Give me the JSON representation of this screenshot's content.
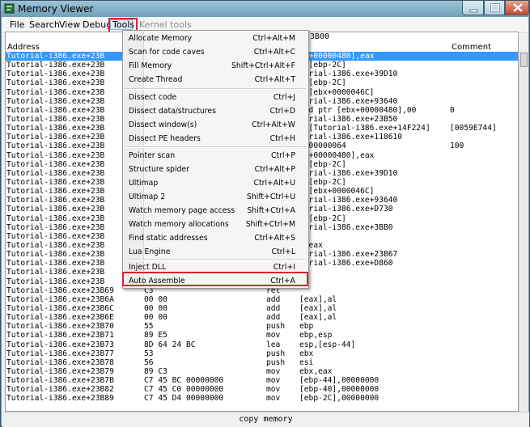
{
  "window": {
    "title": "Memory Viewer",
    "accent_color": "#d9232e",
    "selection_color": "#3399ff"
  },
  "menubar": {
    "items": [
      "File",
      "Search",
      "View",
      "Debug",
      "Tools"
    ],
    "disabled_item": "Kernel tools"
  },
  "header": {
    "address": "Address",
    "comment": "Comment",
    "partial": "3B00"
  },
  "rows": [
    {
      "addr": "Tutorial-i386.exe+23B",
      "bytes": "",
      "op": "",
      "args": "bx+00000480],eax",
      "comment": ""
    },
    {
      "addr": "Tutorial-i386.exe+23B",
      "bytes": "",
      "op": "",
      "args": "x,[ebp-2C]",
      "comment": ""
    },
    {
      "addr": "Tutorial-i386.exe+23B",
      "bytes": "",
      "op": "",
      "args": "torial-i386.exe+39D10",
      "comment": ""
    },
    {
      "addr": "Tutorial-i386.exe+23B",
      "bytes": "",
      "op": "",
      "args": "x,[ebp-2C]",
      "comment": ""
    },
    {
      "addr": "Tutorial-i386.exe+23B",
      "bytes": "",
      "op": "",
      "args": "x,[ebx+0000046C]",
      "comment": ""
    },
    {
      "addr": "Tutorial-i386.exe+23B",
      "bytes": "",
      "op": "",
      "args": "torial-i386.exe+93640",
      "comment": ""
    },
    {
      "addr": "Tutorial-i386.exe+23B",
      "bytes": "",
      "op": "",
      "args": "ord ptr [ebx+00000480],00",
      "comment": "0"
    },
    {
      "addr": "Tutorial-i386.exe+23B",
      "bytes": "",
      "op": "",
      "args": "torial-i386.exe+23B50",
      "comment": ""
    },
    {
      "addr": "Tutorial-i386.exe+23B",
      "bytes": "",
      "op": "",
      "args": "x,[Tutorial-i386.exe+14F224]",
      "comment": "[0059E744]"
    },
    {
      "addr": "Tutorial-i386.exe+23B",
      "bytes": "",
      "op": "",
      "args": "torial-i386.exe+118610",
      "comment": ""
    },
    {
      "addr": "Tutorial-i386.exe+23B",
      "bytes": "",
      "op": "",
      "args": "x,00000064",
      "comment": "100"
    },
    {
      "addr": "Tutorial-i386.exe+23B",
      "bytes": "",
      "op": "",
      "args": "bx+00000480],eax",
      "comment": ""
    },
    {
      "addr": "Tutorial-i386.exe+23B",
      "bytes": "",
      "op": "",
      "args": "x,[ebp-2C]",
      "comment": ""
    },
    {
      "addr": "Tutorial-i386.exe+23B",
      "bytes": "",
      "op": "",
      "args": "torial-i386.exe+39D10",
      "comment": ""
    },
    {
      "addr": "Tutorial-i386.exe+23B",
      "bytes": "",
      "op": "",
      "args": "x,[ebp-2C]",
      "comment": ""
    },
    {
      "addr": "Tutorial-i386.exe+23B",
      "bytes": "",
      "op": "",
      "args": "x,[ebx+0000046C]",
      "comment": ""
    },
    {
      "addr": "Tutorial-i386.exe+23B",
      "bytes": "",
      "op": "",
      "args": "torial-i386.exe+93640",
      "comment": ""
    },
    {
      "addr": "Tutorial-i386.exe+23B",
      "bytes": "",
      "op": "",
      "args": "torial-i386.exe+D730",
      "comment": ""
    },
    {
      "addr": "Tutorial-i386.exe+23B",
      "bytes": "",
      "op": "",
      "args": "x,[ebp-2C]",
      "comment": ""
    },
    {
      "addr": "Tutorial-i386.exe+23B",
      "bytes": "",
      "op": "",
      "args": "torial-i386.exe+3BB0",
      "comment": ""
    },
    {
      "addr": "Tutorial-i386.exe+23B",
      "bytes": "",
      "op": "",
      "args": "x",
      "comment": ""
    },
    {
      "addr": "Tutorial-i386.exe+23B",
      "bytes": "",
      "op": "",
      "args": "x,eax",
      "comment": ""
    },
    {
      "addr": "Tutorial-i386.exe+23B",
      "bytes": "",
      "op": "",
      "args": "torial-i386.exe+23B67",
      "comment": ""
    },
    {
      "addr": "Tutorial-i386.exe+23B",
      "bytes": "",
      "op": "",
      "args": "torial-i386.exe+D860",
      "comment": ""
    },
    {
      "addr": "Tutorial-i386.exe+23B",
      "bytes": "",
      "op": "",
      "args": "x",
      "comment": ""
    },
    {
      "addr": "Tutorial-i386.exe+23B",
      "bytes": "",
      "op": "",
      "args": "x",
      "comment": ""
    },
    {
      "addr": "Tutorial-i386.exe+23B69",
      "bytes": "C3",
      "op": "ret",
      "args": "",
      "comment": ""
    },
    {
      "addr": "Tutorial-i386.exe+23B6A",
      "bytes": "00 00",
      "op": "add",
      "args": "[eax],al",
      "comment": ""
    },
    {
      "addr": "Tutorial-i386.exe+23B6C",
      "bytes": "00 00",
      "op": "add",
      "args": "[eax],al",
      "comment": ""
    },
    {
      "addr": "Tutorial-i386.exe+23B6E",
      "bytes": "00 00",
      "op": "add",
      "args": "[eax],al",
      "comment": ""
    },
    {
      "addr": "Tutorial-i386.exe+23B70",
      "bytes": "55",
      "op": "push",
      "args": "ebp",
      "comment": ""
    },
    {
      "addr": "Tutorial-i386.exe+23B71",
      "bytes": "89 E5",
      "op": "mov",
      "args": "ebp,esp",
      "comment": ""
    },
    {
      "addr": "Tutorial-i386.exe+23B73",
      "bytes": "8D 64 24 BC",
      "op": "lea",
      "args": "esp,[esp-44]",
      "comment": ""
    },
    {
      "addr": "Tutorial-i386.exe+23B77",
      "bytes": "53",
      "op": "push",
      "args": "ebx",
      "comment": ""
    },
    {
      "addr": "Tutorial-i386.exe+23B78",
      "bytes": "56",
      "op": "push",
      "args": "esi",
      "comment": ""
    },
    {
      "addr": "Tutorial-i386.exe+23B79",
      "bytes": "89 C3",
      "op": "mov",
      "args": "ebx,eax",
      "comment": ""
    },
    {
      "addr": "Tutorial-i386.exe+23B7B",
      "bytes": "C7 45 BC 00000000",
      "op": "mov",
      "args": "[ebp-44],00000000",
      "comment": ""
    },
    {
      "addr": "Tutorial-i386.exe+23B82",
      "bytes": "C7 45 C0 00000000",
      "op": "mov",
      "args": "[ebp-40],00000000",
      "comment": ""
    },
    {
      "addr": "Tutorial-i386.exe+23B89",
      "bytes": "C7 45 D4 00000000",
      "op": "mov",
      "args": "[ebp-2C],00000000",
      "comment": ""
    }
  ],
  "tools_menu": [
    {
      "label": "Allocate Memory",
      "shortcut": "Ctrl+Alt+M"
    },
    {
      "label": "Scan for code caves",
      "shortcut": "Ctrl+Alt+C"
    },
    {
      "label": "Fill Memory",
      "shortcut": "Shift+Ctrl+Alt+F"
    },
    {
      "label": "Create Thread",
      "shortcut": "Ctrl+Alt+T"
    },
    {
      "label": "Dissect code",
      "shortcut": "Ctrl+J"
    },
    {
      "label": "Dissect data/structures",
      "shortcut": "Ctrl+D"
    },
    {
      "label": "Dissect window(s)",
      "shortcut": "Ctrl+Alt+W"
    },
    {
      "label": "Dissect PE headers",
      "shortcut": "Ctrl+H"
    },
    {
      "label": "Pointer scan",
      "shortcut": "Ctrl+P"
    },
    {
      "label": "Structure spider",
      "shortcut": "Ctrl+Alt+P"
    },
    {
      "label": "Ultimap",
      "shortcut": "Ctrl+Alt+U"
    },
    {
      "label": "Ultimap 2",
      "shortcut": "Shift+Ctrl+U"
    },
    {
      "label": "Watch memory page access",
      "shortcut": "Shift+Ctrl+A"
    },
    {
      "label": "Watch memory allocations",
      "shortcut": "Shift+Ctrl+M"
    },
    {
      "label": "Find static addresses",
      "shortcut": "Ctrl+Alt+S"
    },
    {
      "label": "Lua Engine",
      "shortcut": "Ctrl+L"
    },
    {
      "label": "Inject DLL",
      "shortcut": "Ctrl+I"
    },
    {
      "label": "Auto Assemble",
      "shortcut": "Ctrl+A"
    }
  ],
  "bottom": {
    "copy_label": "copy memory"
  }
}
